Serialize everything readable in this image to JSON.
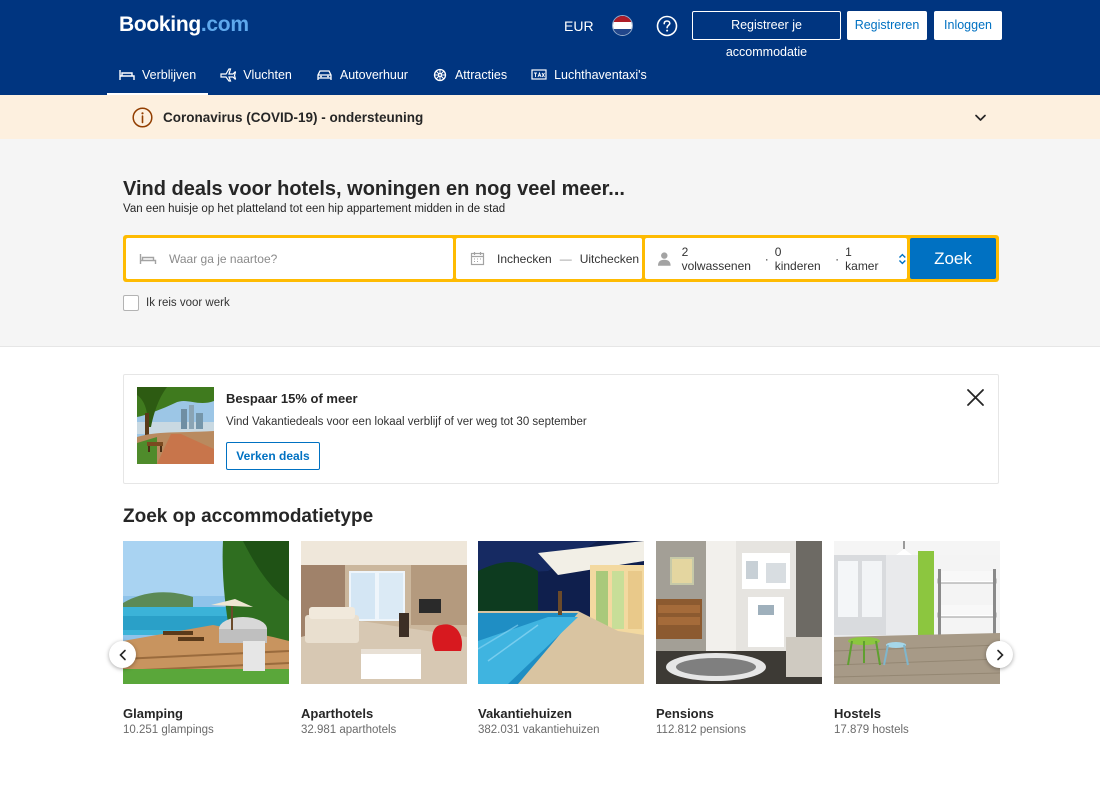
{
  "header": {
    "logo_main": "Booking",
    "logo_suffix": ".com",
    "currency": "EUR",
    "register_property": "Registreer je accommodatie",
    "register": "Registreren",
    "login": "Inloggen"
  },
  "nav": {
    "items": [
      {
        "label": "Verblijven",
        "icon": "bed-icon",
        "active": true
      },
      {
        "label": "Vluchten",
        "icon": "plane-icon",
        "active": false
      },
      {
        "label": "Autoverhuur",
        "icon": "car-icon",
        "active": false
      },
      {
        "label": "Attracties",
        "icon": "attractions-icon",
        "active": false
      },
      {
        "label": "Luchthaventaxi's",
        "icon": "taxi-icon",
        "active": false
      }
    ]
  },
  "covid_banner": {
    "text": "Coronavirus (COVID-19) - ondersteuning"
  },
  "hero": {
    "title": "Vind deals voor hotels, woningen en nog veel meer...",
    "subtitle": "Van een huisje op het platteland tot een hip appartement midden in de stad"
  },
  "search": {
    "destination_placeholder": "Waar ga je naartoe?",
    "checkin": "Inchecken",
    "date_separator": "—",
    "checkout": "Uitchecken",
    "adults": "2 volwassenen",
    "children": "0 kinderen",
    "rooms": "1 kamer",
    "guest_separator": "·",
    "button": "Zoek",
    "work_travel": "Ik reis voor werk"
  },
  "promo": {
    "title": "Bespaar 15% of meer",
    "text": "Vind Vakantiedeals voor een lokaal verblijf of ver weg tot 30 september",
    "button": "Verken deals"
  },
  "accommodation_types": {
    "title": "Zoek op accommodatietype",
    "items": [
      {
        "name": "Glamping",
        "count": "10.251 glampings"
      },
      {
        "name": "Aparthotels",
        "count": "32.981 aparthotels"
      },
      {
        "name": "Vakantiehuizen",
        "count": "382.031 vakantiehuizen"
      },
      {
        "name": "Pensions",
        "count": "112.812 pensions"
      },
      {
        "name": "Hostels",
        "count": "17.879 hostels"
      }
    ]
  },
  "colors": {
    "brand_blue": "#003580",
    "action_blue": "#0071c2",
    "search_yellow": "#febb02",
    "banner_bg": "#fdf0df"
  }
}
